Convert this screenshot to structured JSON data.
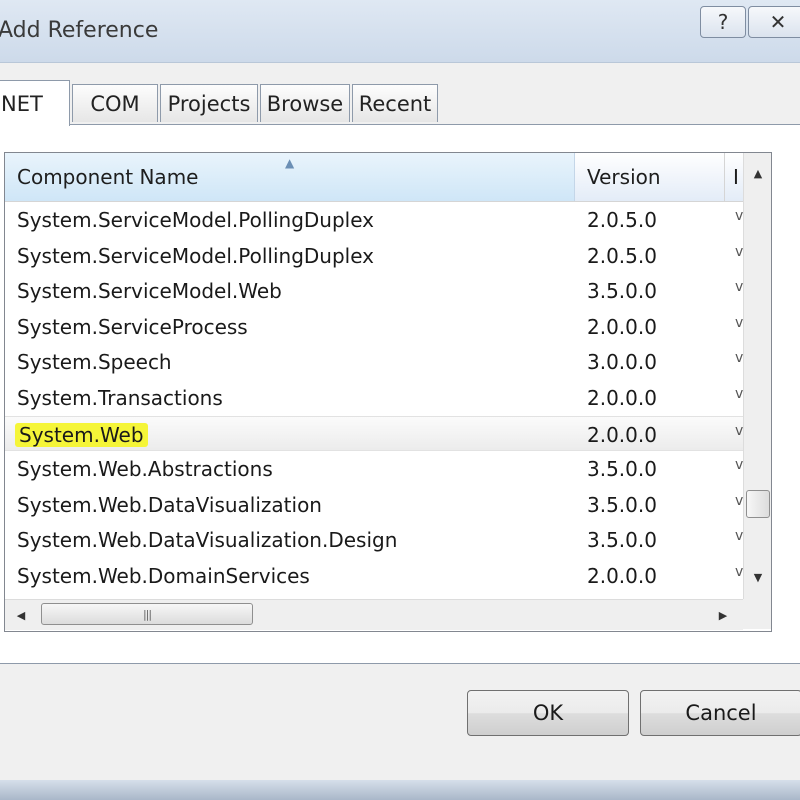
{
  "window": {
    "title": "Add Reference",
    "help_glyph": "?",
    "close_glyph": "✕"
  },
  "tabs": [
    {
      "label": "NET",
      "active": true
    },
    {
      "label": "COM",
      "active": false
    },
    {
      "label": "Projects",
      "active": false
    },
    {
      "label": "Browse",
      "active": false
    },
    {
      "label": "Recent",
      "active": false
    }
  ],
  "list": {
    "columns": {
      "name": "Component Name",
      "version": "Version",
      "extra": "I"
    },
    "sort_indicator": "▲",
    "rows": [
      {
        "name": "System.ServiceModel.PollingDuplex",
        "version": "2.0.5.0",
        "extra": "v"
      },
      {
        "name": "System.ServiceModel.PollingDuplex",
        "version": "2.0.5.0",
        "extra": "v"
      },
      {
        "name": "System.ServiceModel.Web",
        "version": "3.5.0.0",
        "extra": "v"
      },
      {
        "name": "System.ServiceProcess",
        "version": "2.0.0.0",
        "extra": "v"
      },
      {
        "name": "System.Speech",
        "version": "3.0.0.0",
        "extra": "v"
      },
      {
        "name": "System.Transactions",
        "version": "2.0.0.0",
        "extra": "v"
      },
      {
        "name": "System.Web",
        "version": "2.0.0.0",
        "extra": "v"
      },
      {
        "name": "System.Web.Abstractions",
        "version": "3.5.0.0",
        "extra": "v"
      },
      {
        "name": "System.Web.DataVisualization",
        "version": "3.5.0.0",
        "extra": "v"
      },
      {
        "name": "System.Web.DataVisualization.Design",
        "version": "3.5.0.0",
        "extra": "v"
      },
      {
        "name": "System.Web.DomainServices",
        "version": "2.0.0.0",
        "extra": "v"
      }
    ],
    "selected_index": 6,
    "highlight_color": "#f5f538"
  },
  "scroll": {
    "up_glyph": "▲",
    "down_glyph": "▼",
    "left_glyph": "◀",
    "right_glyph": "▶",
    "grip": "|||"
  },
  "buttons": {
    "ok": "OK",
    "cancel": "Cancel"
  }
}
